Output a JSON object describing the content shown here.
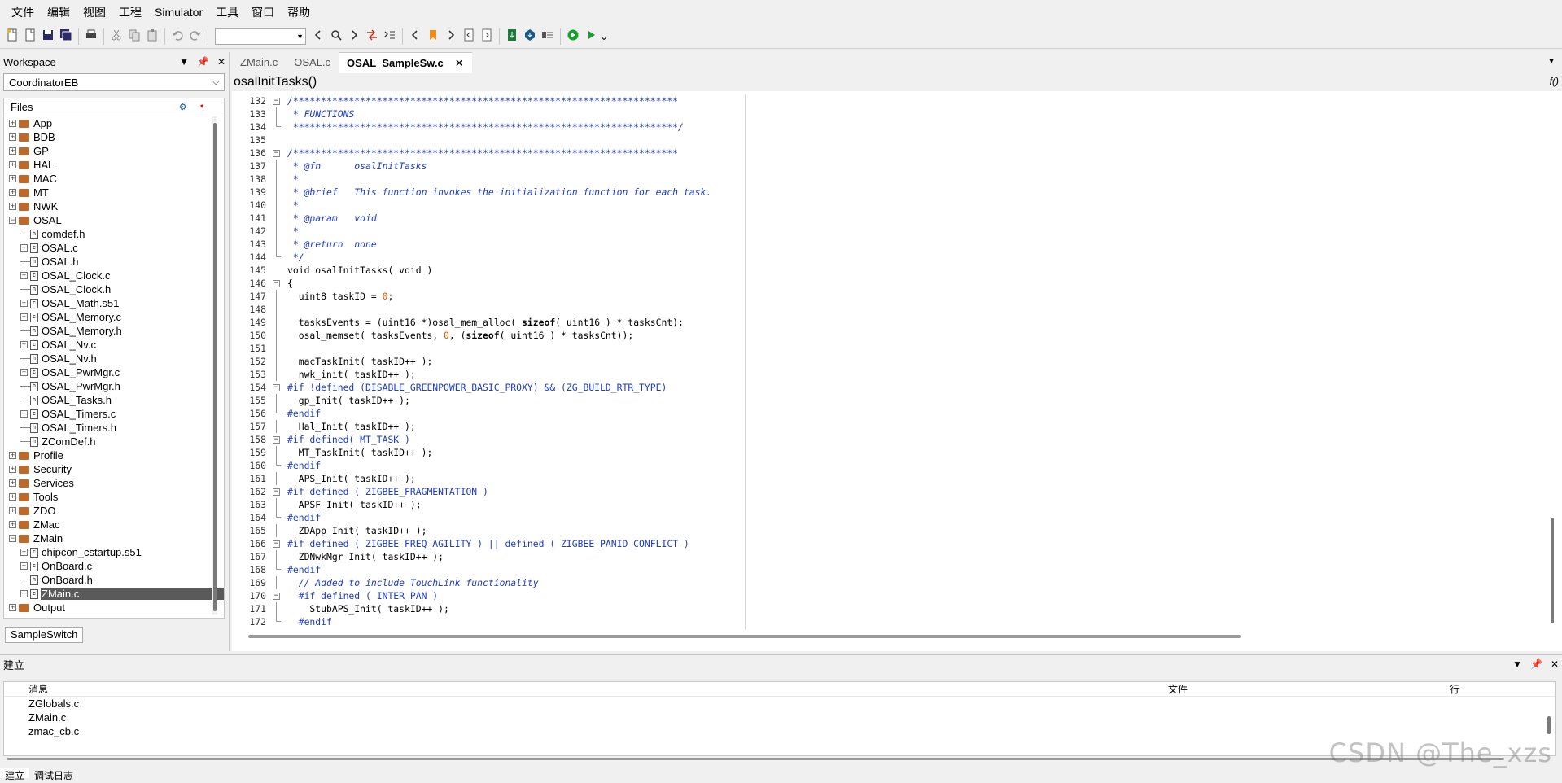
{
  "menu": [
    "文件",
    "编辑",
    "视图",
    "工程",
    "Simulator",
    "工具",
    "窗口",
    "帮助"
  ],
  "toolbar": {
    "icons": [
      "new-file-icon",
      "new-file2-icon",
      "save-icon",
      "save-all-icon",
      "print-icon",
      "cut-icon",
      "copy-icon",
      "paste-icon",
      "undo-icon",
      "redo-icon",
      "combo",
      "back-icon",
      "find-icon",
      "forward-icon",
      "find-replace-icon",
      "go-to-icon",
      "prev-icon",
      "bookmark-icon",
      "next-icon",
      "doc-prev-icon",
      "doc-next-icon",
      "download-icon",
      "download-debug-icon",
      "make-icon",
      "debug-icon",
      "run-icon"
    ],
    "combo_value": "",
    "colors": {
      "debug": "#1a9e2d",
      "bookmark": "#f08c1a"
    }
  },
  "workspace": {
    "title": "Workspace",
    "configuration": "CoordinatorEB",
    "files_header": "Files",
    "tab": "SampleSwitch",
    "tree": [
      {
        "label": "App",
        "type": "folder",
        "depth": 0,
        "expanded": false
      },
      {
        "label": "BDB",
        "type": "folder",
        "depth": 0,
        "expanded": false
      },
      {
        "label": "GP",
        "type": "folder",
        "depth": 0,
        "expanded": false
      },
      {
        "label": "HAL",
        "type": "folder",
        "depth": 0,
        "expanded": false
      },
      {
        "label": "MAC",
        "type": "folder",
        "depth": 0,
        "expanded": false
      },
      {
        "label": "MT",
        "type": "folder",
        "depth": 0,
        "expanded": false
      },
      {
        "label": "NWK",
        "type": "folder",
        "depth": 0,
        "expanded": false
      },
      {
        "label": "OSAL",
        "type": "folder",
        "depth": 0,
        "expanded": true
      },
      {
        "label": "comdef.h",
        "type": "h",
        "depth": 1,
        "expandable": false
      },
      {
        "label": "OSAL.c",
        "type": "c",
        "depth": 1,
        "expandable": true
      },
      {
        "label": "OSAL.h",
        "type": "h",
        "depth": 1,
        "expandable": false
      },
      {
        "label": "OSAL_Clock.c",
        "type": "c",
        "depth": 1,
        "expandable": true
      },
      {
        "label": "OSAL_Clock.h",
        "type": "h",
        "depth": 1,
        "expandable": false
      },
      {
        "label": "OSAL_Math.s51",
        "type": "c",
        "depth": 1,
        "expandable": true
      },
      {
        "label": "OSAL_Memory.c",
        "type": "c",
        "depth": 1,
        "expandable": true
      },
      {
        "label": "OSAL_Memory.h",
        "type": "h",
        "depth": 1,
        "expandable": false
      },
      {
        "label": "OSAL_Nv.c",
        "type": "c",
        "depth": 1,
        "expandable": true
      },
      {
        "label": "OSAL_Nv.h",
        "type": "h",
        "depth": 1,
        "expandable": false
      },
      {
        "label": "OSAL_PwrMgr.c",
        "type": "c",
        "depth": 1,
        "expandable": true
      },
      {
        "label": "OSAL_PwrMgr.h",
        "type": "h",
        "depth": 1,
        "expandable": false
      },
      {
        "label": "OSAL_Tasks.h",
        "type": "h",
        "depth": 1,
        "expandable": false
      },
      {
        "label": "OSAL_Timers.c",
        "type": "c",
        "depth": 1,
        "expandable": true
      },
      {
        "label": "OSAL_Timers.h",
        "type": "h",
        "depth": 1,
        "expandable": false
      },
      {
        "label": "ZComDef.h",
        "type": "h",
        "depth": 1,
        "expandable": false
      },
      {
        "label": "Profile",
        "type": "folder",
        "depth": 0,
        "expanded": false
      },
      {
        "label": "Security",
        "type": "folder",
        "depth": 0,
        "expanded": false
      },
      {
        "label": "Services",
        "type": "folder",
        "depth": 0,
        "expanded": false
      },
      {
        "label": "Tools",
        "type": "folder",
        "depth": 0,
        "expanded": false
      },
      {
        "label": "ZDO",
        "type": "folder",
        "depth": 0,
        "expanded": false
      },
      {
        "label": "ZMac",
        "type": "folder",
        "depth": 0,
        "expanded": false
      },
      {
        "label": "ZMain",
        "type": "folder",
        "depth": 0,
        "expanded": true
      },
      {
        "label": "chipcon_cstartup.s51",
        "type": "c",
        "depth": 1,
        "expandable": true
      },
      {
        "label": "OnBoard.c",
        "type": "c",
        "depth": 1,
        "expandable": true
      },
      {
        "label": "OnBoard.h",
        "type": "h",
        "depth": 1,
        "expandable": false
      },
      {
        "label": "ZMain.c",
        "type": "c",
        "depth": 1,
        "expandable": true,
        "selected": true
      },
      {
        "label": "Output",
        "type": "folder",
        "depth": 0,
        "expanded": false
      }
    ]
  },
  "editor": {
    "tabs": [
      {
        "label": "ZMain.c",
        "active": false
      },
      {
        "label": "OSAL.c",
        "active": false
      },
      {
        "label": "OSAL_SampleSw.c",
        "active": true
      }
    ],
    "close_glyph": "✕",
    "function_name": "osalInitTasks()",
    "function_symbol": "f()",
    "lines": [
      {
        "n": "132",
        "fold": "box",
        "text": "/*********************************************************************",
        "style": "comment"
      },
      {
        "n": "133",
        "fold": "bar",
        "text": " * FUNCTIONS",
        "style": "comment"
      },
      {
        "n": "134",
        "fold": "end",
        "text": " *********************************************************************/",
        "style": "comment"
      },
      {
        "n": "135",
        "fold": "",
        "text": "",
        "style": ""
      },
      {
        "n": "136",
        "fold": "box",
        "text": "/*********************************************************************",
        "style": "comment"
      },
      {
        "n": "137",
        "fold": "bar",
        "text": " * @fn      osalInitTasks",
        "style": "comment"
      },
      {
        "n": "138",
        "fold": "bar",
        "text": " *",
        "style": "comment"
      },
      {
        "n": "139",
        "fold": "bar",
        "text": " * @brief   This function invokes the initialization function for each task.",
        "style": "comment"
      },
      {
        "n": "140",
        "fold": "bar",
        "text": " *",
        "style": "comment"
      },
      {
        "n": "141",
        "fold": "bar",
        "text": " * @param   void",
        "style": "comment"
      },
      {
        "n": "142",
        "fold": "bar",
        "text": " *",
        "style": "comment"
      },
      {
        "n": "143",
        "fold": "bar",
        "text": " * @return  none",
        "style": "comment"
      },
      {
        "n": "144",
        "fold": "end",
        "text": " */",
        "style": "comment"
      },
      {
        "n": "145",
        "fold": "",
        "text": "void osalInitTasks( void )",
        "style": "code"
      },
      {
        "n": "146",
        "fold": "box",
        "text": "{",
        "style": "code"
      },
      {
        "n": "147",
        "fold": "bar",
        "text": "  uint8 taskID = 0;",
        "style": "code"
      },
      {
        "n": "148",
        "fold": "bar",
        "text": "",
        "style": ""
      },
      {
        "n": "149",
        "fold": "bar",
        "text": "  tasksEvents = (uint16 *)osal_mem_alloc( sizeof( uint16 ) * tasksCnt);",
        "style": "code"
      },
      {
        "n": "150",
        "fold": "bar",
        "text": "  osal_memset( tasksEvents, 0, (sizeof( uint16 ) * tasksCnt));",
        "style": "code"
      },
      {
        "n": "151",
        "fold": "bar",
        "text": "",
        "style": ""
      },
      {
        "n": "152",
        "fold": "bar",
        "text": "  macTaskInit( taskID++ );",
        "style": "code"
      },
      {
        "n": "153",
        "fold": "bar",
        "text": "  nwk_init( taskID++ );",
        "style": "code"
      },
      {
        "n": "154",
        "fold": "box",
        "text": "#if !defined (DISABLE_GREENPOWER_BASIC_PROXY) && (ZG_BUILD_RTR_TYPE)",
        "style": "pre"
      },
      {
        "n": "155",
        "fold": "bar",
        "text": "  gp_Init( taskID++ );",
        "style": "code"
      },
      {
        "n": "156",
        "fold": "end",
        "text": "#endif",
        "style": "pre"
      },
      {
        "n": "157",
        "fold": "bar",
        "text": "  Hal_Init( taskID++ );",
        "style": "code"
      },
      {
        "n": "158",
        "fold": "box",
        "text": "#if defined( MT_TASK )",
        "style": "pre"
      },
      {
        "n": "159",
        "fold": "bar",
        "text": "  MT_TaskInit( taskID++ );",
        "style": "code"
      },
      {
        "n": "160",
        "fold": "end",
        "text": "#endif",
        "style": "pre"
      },
      {
        "n": "161",
        "fold": "bar",
        "text": "  APS_Init( taskID++ );",
        "style": "code"
      },
      {
        "n": "162",
        "fold": "box",
        "text": "#if defined ( ZIGBEE_FRAGMENTATION )",
        "style": "pre"
      },
      {
        "n": "163",
        "fold": "bar",
        "text": "  APSF_Init( taskID++ );",
        "style": "code"
      },
      {
        "n": "164",
        "fold": "end",
        "text": "#endif",
        "style": "pre"
      },
      {
        "n": "165",
        "fold": "bar",
        "text": "  ZDApp_Init( taskID++ );",
        "style": "code"
      },
      {
        "n": "166",
        "fold": "box",
        "text": "#if defined ( ZIGBEE_FREQ_AGILITY ) || defined ( ZIGBEE_PANID_CONFLICT )",
        "style": "pre"
      },
      {
        "n": "167",
        "fold": "bar",
        "text": "  ZDNwkMgr_Init( taskID++ );",
        "style": "code"
      },
      {
        "n": "168",
        "fold": "end",
        "text": "#endif",
        "style": "pre"
      },
      {
        "n": "169",
        "fold": "bar",
        "text": "  // Added to include TouchLink functionality",
        "style": "comment"
      },
      {
        "n": "170",
        "fold": "box",
        "text": "  #if defined ( INTER_PAN )",
        "style": "pre"
      },
      {
        "n": "171",
        "fold": "bar",
        "text": "    StubAPS_Init( taskID++ );",
        "style": "code"
      },
      {
        "n": "172",
        "fold": "end",
        "text": "  #endif",
        "style": "pre"
      }
    ],
    "colors": {
      "comment": "#1e3cc8",
      "number": "#d45500"
    }
  },
  "build": {
    "title": "建立",
    "columns": {
      "message": "消息",
      "file": "文件",
      "line": "行"
    },
    "rows": [
      "ZGlobals.c",
      "ZMain.c",
      "zmac_cb.c"
    ],
    "bottom_tabs": [
      "建立",
      "调试日志"
    ]
  },
  "watermark": "CSDN @The_xzs"
}
